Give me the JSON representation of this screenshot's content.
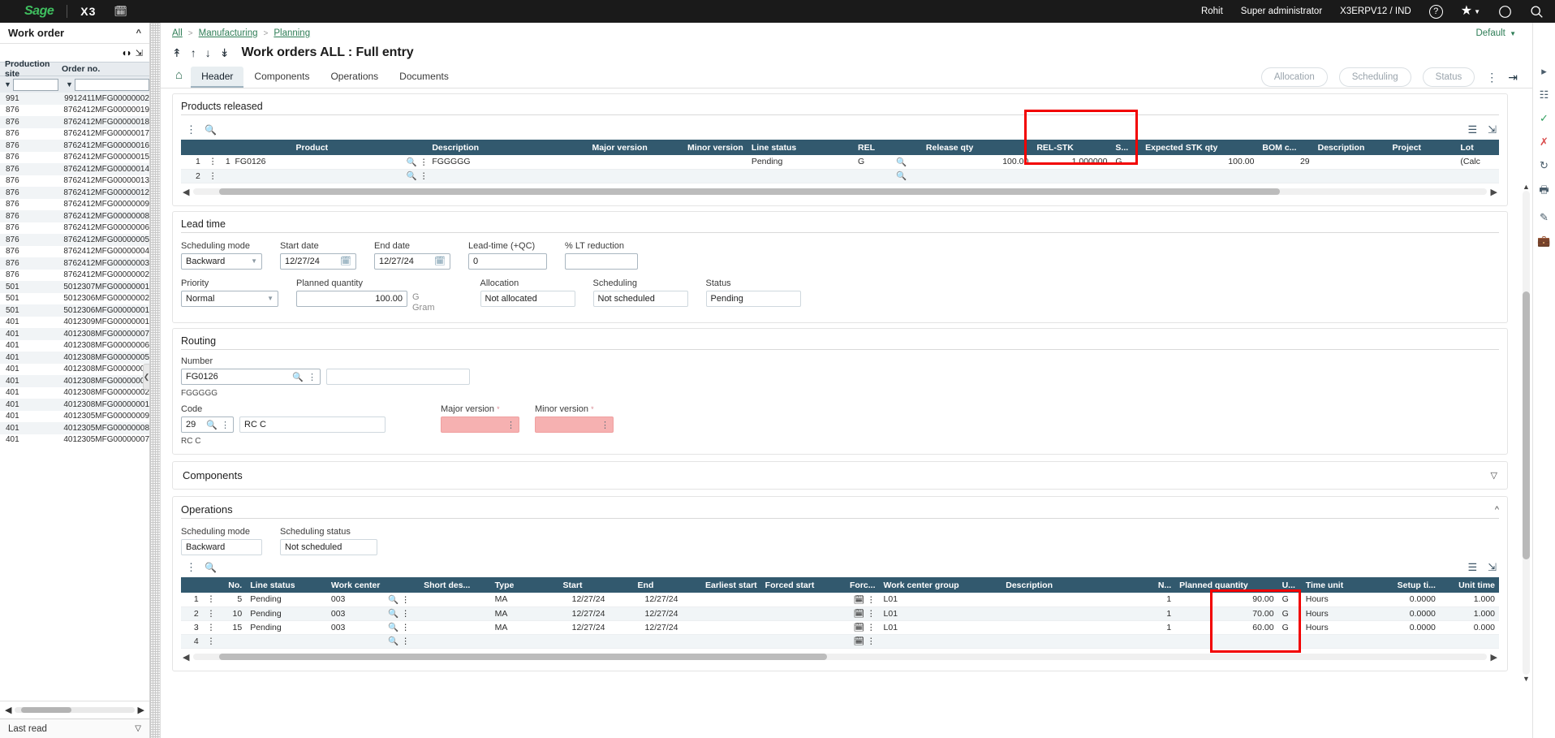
{
  "topbar": {
    "logo": "Sage",
    "product": "X3",
    "calendar_icon": "calendar-icon",
    "user": "Rohit",
    "role": "Super administrator",
    "endpoint": "X3ERPV12 / IND",
    "help_icon": "help-icon",
    "favorites_icon": "star-icon",
    "compass_icon": "compass-icon",
    "search_icon": "search-icon"
  },
  "left_panel": {
    "title": "Work order",
    "collapse_icon": "chevron-up-icon",
    "prev_icon": "previous-page-icon",
    "next_icon": "next-page-icon",
    "expand_icon": "expand-icon",
    "columns": [
      "Production site",
      "Order no."
    ],
    "filter_placeholder": "",
    "rows": [
      {
        "site": "991",
        "order": "9912411MFG00000002"
      },
      {
        "site": "876",
        "order": "8762412MFG00000019"
      },
      {
        "site": "876",
        "order": "8762412MFG00000018"
      },
      {
        "site": "876",
        "order": "8762412MFG00000017"
      },
      {
        "site": "876",
        "order": "8762412MFG00000016"
      },
      {
        "site": "876",
        "order": "8762412MFG00000015"
      },
      {
        "site": "876",
        "order": "8762412MFG00000014"
      },
      {
        "site": "876",
        "order": "8762412MFG00000013"
      },
      {
        "site": "876",
        "order": "8762412MFG00000012"
      },
      {
        "site": "876",
        "order": "8762412MFG00000009"
      },
      {
        "site": "876",
        "order": "8762412MFG00000008"
      },
      {
        "site": "876",
        "order": "8762412MFG00000006"
      },
      {
        "site": "876",
        "order": "8762412MFG00000005"
      },
      {
        "site": "876",
        "order": "8762412MFG00000004"
      },
      {
        "site": "876",
        "order": "8762412MFG00000003"
      },
      {
        "site": "876",
        "order": "8762412MFG00000002"
      },
      {
        "site": "501",
        "order": "5012307MFG00000001"
      },
      {
        "site": "501",
        "order": "5012306MFG00000002"
      },
      {
        "site": "501",
        "order": "5012306MFG00000001"
      },
      {
        "site": "401",
        "order": "4012309MFG00000001"
      },
      {
        "site": "401",
        "order": "4012308MFG00000007"
      },
      {
        "site": "401",
        "order": "4012308MFG00000006"
      },
      {
        "site": "401",
        "order": "4012308MFG00000005"
      },
      {
        "site": "401",
        "order": "4012308MFG00000004"
      },
      {
        "site": "401",
        "order": "4012308MFG00000003"
      },
      {
        "site": "401",
        "order": "4012308MFG00000002"
      },
      {
        "site": "401",
        "order": "4012308MFG00000001"
      },
      {
        "site": "401",
        "order": "4012305MFG00000009"
      },
      {
        "site": "401",
        "order": "4012305MFG00000008"
      },
      {
        "site": "401",
        "order": "4012305MFG00000007"
      }
    ],
    "footer": "Last read",
    "footer_chevron": "chevron-down-icon"
  },
  "breadcrumb": {
    "items": [
      "All",
      "Manufacturing",
      "Planning"
    ],
    "separator": ">",
    "view_label": "Default",
    "view_caret": "caret-down-icon"
  },
  "page": {
    "title": "Work orders ALL : Full entry",
    "nav_first_icon": "first-record-icon",
    "nav_prev_icon": "previous-record-icon",
    "nav_next_icon": "next-record-icon",
    "nav_last_icon": "last-record-icon"
  },
  "tabs": {
    "home_icon": "home-icon",
    "items": [
      {
        "label": "Header",
        "active": true
      },
      {
        "label": "Components",
        "active": false
      },
      {
        "label": "Operations",
        "active": false
      },
      {
        "label": "Documents",
        "active": false
      }
    ],
    "actions": [
      "Allocation",
      "Scheduling",
      "Status"
    ],
    "more_icon": "kebab-menu-icon",
    "exit_icon": "exit-icon",
    "layout_icon_1": "text-layout-icon",
    "layout_icon_2": "grid-layout-icon"
  },
  "products_released": {
    "section_title": "Products released",
    "kebab_icon": "kebab-menu-icon",
    "search_icon": "search-icon",
    "layers_icon": "layers-icon",
    "expand_icon": "expand-icon",
    "columns": [
      "Product",
      "Description",
      "Major version",
      "Minor version",
      "Line status",
      "REL",
      "Release qty",
      "REL-STK",
      "S...",
      "Expected STK qty",
      "BOM c...",
      "Description",
      "Project",
      "Lot"
    ],
    "rows": [
      {
        "n": "1",
        "seq": "1",
        "product": "FG0126",
        "description": "FGGGGG",
        "major_version": "",
        "minor_version": "",
        "line_status": "Pending",
        "rel": "G",
        "release_qty": "100.00",
        "rel_stk": "1.000000",
        "s": "G",
        "expected_stk_qty": "100.00",
        "bom_c": "29",
        "description2": "",
        "project": "",
        "lot": "(Calc"
      },
      {
        "n": "2",
        "seq": "",
        "product": "",
        "description": "",
        "major_version": "",
        "minor_version": "",
        "line_status": "",
        "rel": "",
        "release_qty": "",
        "rel_stk": "",
        "s": "",
        "expected_stk_qty": "",
        "bom_c": "",
        "description2": "",
        "project": "",
        "lot": ""
      }
    ]
  },
  "lead_time": {
    "section_title": "Lead time",
    "scheduling_mode_label": "Scheduling mode",
    "scheduling_mode_value": "Backward",
    "start_date_label": "Start date",
    "start_date_value": "12/27/24",
    "end_date_label": "End date",
    "end_date_value": "12/27/24",
    "lead_time_label": "Lead-time (+QC)",
    "lead_time_value": "0",
    "lt_reduction_label": "% LT reduction",
    "lt_reduction_value": "",
    "priority_label": "Priority",
    "priority_value": "Normal",
    "planned_qty_label": "Planned quantity",
    "planned_qty_value": "100.00",
    "planned_qty_unit": "G",
    "planned_qty_unit_sub": "Gram",
    "allocation_label": "Allocation",
    "allocation_value": "Not allocated",
    "scheduling_label": "Scheduling",
    "scheduling_value": "Not scheduled",
    "status_label": "Status",
    "status_value": "Pending",
    "calendar_icon": "calendar-icon",
    "caret_icon": "caret-down-icon"
  },
  "routing": {
    "section_title": "Routing",
    "number_label": "Number",
    "number_value": "FG0126",
    "number_desc_value": "",
    "number_sub": "FGGGGG",
    "code_label": "Code",
    "code_value": "29",
    "code_name_value": "RC C",
    "code_sub": "RC C",
    "major_version_label": "Major version",
    "major_version_value": "",
    "minor_version_label": "Minor version",
    "minor_version_value": "",
    "required_marker": "*",
    "search_icon": "search-icon",
    "kebab_icon": "kebab-menu-icon"
  },
  "components": {
    "section_title": "Components",
    "chevron": "chevron-down-icon"
  },
  "operations": {
    "section_title": "Operations",
    "chevron": "chevron-up-icon",
    "scheduling_mode_label": "Scheduling mode",
    "scheduling_mode_value": "Backward",
    "scheduling_status_label": "Scheduling status",
    "scheduling_status_value": "Not scheduled",
    "kebab_icon": "kebab-menu-icon",
    "search_icon": "search-icon",
    "layers_icon": "layers-icon",
    "expand_icon": "expand-icon",
    "columns": [
      "No.",
      "Line status",
      "Work center",
      "Short des...",
      "Type",
      "Start",
      "End",
      "Earliest start",
      "Forced start",
      "Forc...",
      "Work center group",
      "Description",
      "N...",
      "Planned quantity",
      "U...",
      "Time unit",
      "Setup ti...",
      "Unit time"
    ],
    "rows": [
      {
        "n": "1",
        "no": "5",
        "line_status": "Pending",
        "work_center": "003",
        "short_desc": "",
        "type": "MA",
        "start": "12/27/24",
        "end": "12/27/24",
        "earliest_start": "",
        "forced_start": "",
        "forc": "",
        "wc_group": "L01",
        "description": "",
        "nn": "1",
        "planned_quantity": "90.00",
        "u": "G",
        "time_unit": "Hours",
        "setup_time": "0.0000",
        "unit_time": "1.000"
      },
      {
        "n": "2",
        "no": "10",
        "line_status": "Pending",
        "work_center": "003",
        "short_desc": "",
        "type": "MA",
        "start": "12/27/24",
        "end": "12/27/24",
        "earliest_start": "",
        "forced_start": "",
        "forc": "",
        "wc_group": "L01",
        "description": "",
        "nn": "1",
        "planned_quantity": "70.00",
        "u": "G",
        "time_unit": "Hours",
        "setup_time": "0.0000",
        "unit_time": "1.000"
      },
      {
        "n": "3",
        "no": "15",
        "line_status": "Pending",
        "work_center": "003",
        "short_desc": "",
        "type": "MA",
        "start": "12/27/24",
        "end": "12/27/24",
        "earliest_start": "",
        "forced_start": "",
        "forc": "",
        "wc_group": "L01",
        "description": "",
        "nn": "1",
        "planned_quantity": "60.00",
        "u": "G",
        "time_unit": "Hours",
        "setup_time": "0.0000",
        "unit_time": "0.000"
      },
      {
        "n": "4",
        "no": "",
        "line_status": "",
        "work_center": "",
        "short_desc": "",
        "type": "",
        "start": "",
        "end": "",
        "earliest_start": "",
        "forced_start": "",
        "forc": "",
        "wc_group": "",
        "description": "",
        "nn": "",
        "planned_quantity": "",
        "u": "",
        "time_unit": "",
        "setup_time": "",
        "unit_time": ""
      }
    ]
  },
  "right_rail": {
    "icons": [
      "collapse-panel-icon",
      "list-icon",
      "check-icon",
      "close-icon",
      "refresh-icon",
      "print-icon",
      "edit-icon",
      "briefcase-icon"
    ]
  },
  "annotations": {
    "highlight_color": "#f20000",
    "boxes": [
      "release-qty-column",
      "planned-quantity-column"
    ]
  }
}
